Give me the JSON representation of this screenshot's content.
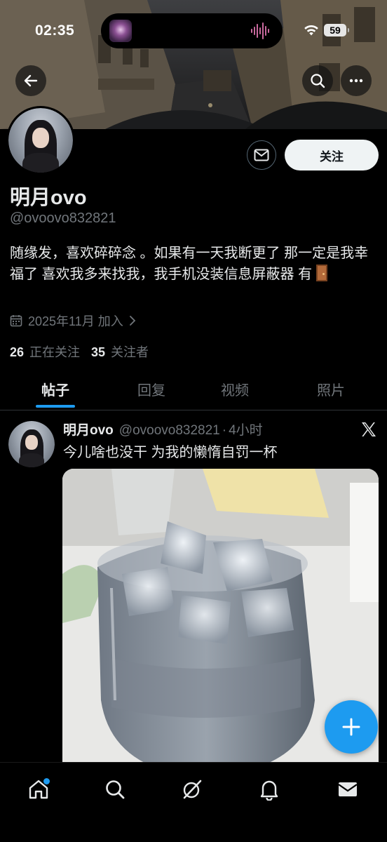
{
  "status_bar": {
    "time": "02:35",
    "battery": "59"
  },
  "profile": {
    "display_name": "明月ovo",
    "handle": "@ovoovo832821",
    "bio_text": "随缘发，喜欢碎碎念 。如果有一天我断更了 那一定是我幸福了 喜欢我多来找我，我手机没装信息屏蔽器 有",
    "bio_emoji": "door",
    "joined": "2025年11月 加入",
    "following_count": "26",
    "following_label": "正在关注",
    "followers_count": "35",
    "followers_label": "关注者",
    "follow_button": "关注"
  },
  "tabs": [
    {
      "label": "帖子",
      "active": true
    },
    {
      "label": "回复",
      "active": false
    },
    {
      "label": "视频",
      "active": false
    },
    {
      "label": "照片",
      "active": false
    }
  ],
  "post": {
    "name": "明月ovo",
    "handle": "@ovoovo832821",
    "separator": "·",
    "time": "4小时",
    "text": "今儿啥也没干 为我的懒惰自罚一杯",
    "media": "photo"
  },
  "icons": {
    "back": "back-arrow-icon",
    "search": "search-icon",
    "more": "more-icon",
    "mail": "mail-icon",
    "calendar": "calendar-icon",
    "x_logo": "x-logo-icon",
    "compose": "plus-icon",
    "nav": [
      "home-icon",
      "search-icon",
      "grok-icon",
      "bell-icon",
      "mail-icon"
    ]
  },
  "colors": {
    "accent": "#1d9bf0",
    "background": "#000000",
    "secondary_text": "#71767b"
  }
}
